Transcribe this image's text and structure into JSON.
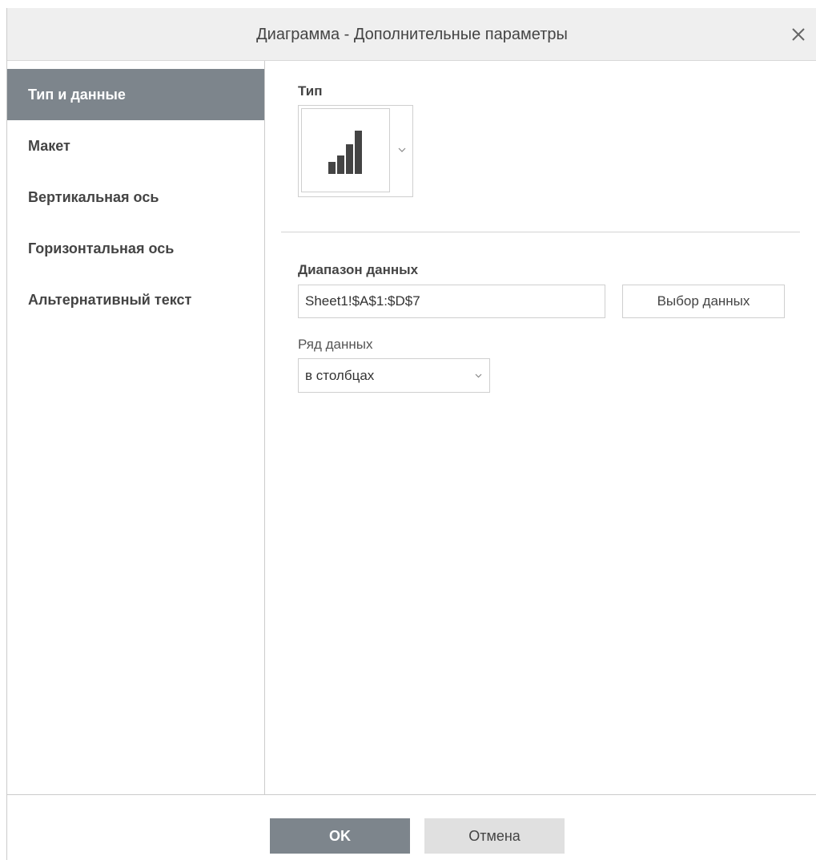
{
  "dialog": {
    "title": "Диаграмма - Дополнительные параметры"
  },
  "sidebar": {
    "items": [
      {
        "label": "Тип и данные",
        "active": true
      },
      {
        "label": "Макет",
        "active": false
      },
      {
        "label": "Вертикальная ось",
        "active": false
      },
      {
        "label": "Горизонтальная ось",
        "active": false
      },
      {
        "label": "Альтернативный текст",
        "active": false
      }
    ]
  },
  "main": {
    "type_label": "Тип",
    "type_icon": "bar-chart-icon",
    "data_range_label": "Диапазон данных",
    "data_range_value": "Sheet1!$A$1:$D$7",
    "select_data_button": "Выбор данных",
    "series_label": "Ряд данных",
    "series_value": "в столбцах"
  },
  "footer": {
    "ok_label": "OK",
    "cancel_label": "Отмена"
  },
  "colors": {
    "accent": "#7d858c",
    "title_bar": "#efefef",
    "cancel_button": "#e0e0e0"
  }
}
